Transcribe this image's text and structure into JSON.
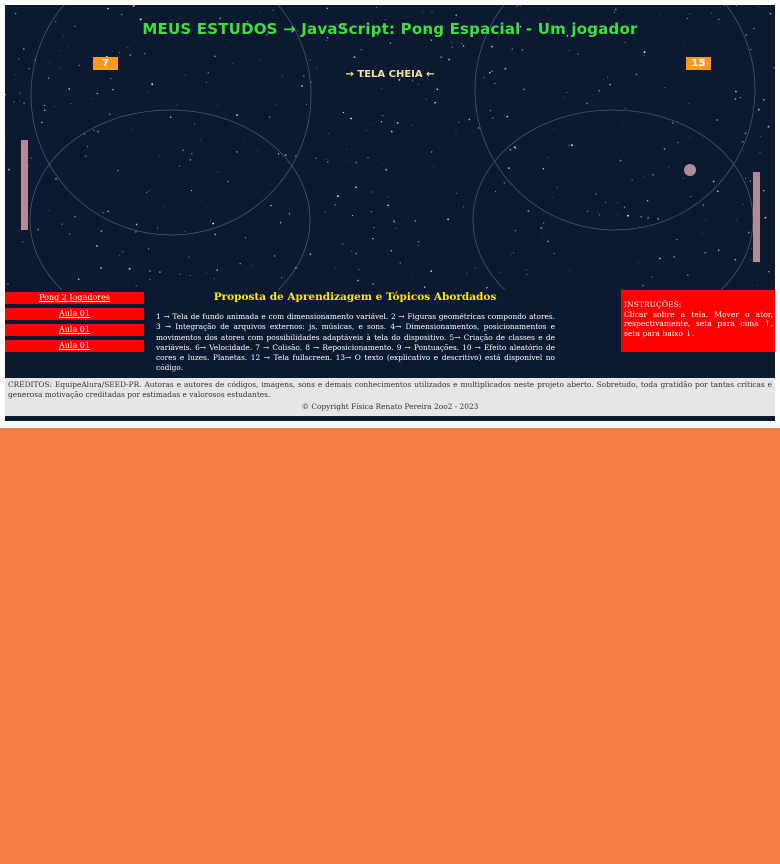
{
  "page": {
    "title": "MEUS ESTUDOS → JavaScript: Pong Espacial - Um jogador",
    "fullscreen_link": "→ TELA CHEIA ←"
  },
  "game": {
    "score_left": "7",
    "score_right": "15",
    "colors": {
      "background": "#0b1a30",
      "paddle": "#b48a98",
      "score_badge": "#ff9a1f",
      "title": "#3ee03e"
    }
  },
  "nav": {
    "items": [
      {
        "label": "Pong 2 Jogadores"
      },
      {
        "label": "Aula 01"
      },
      {
        "label": "Aula 01"
      },
      {
        "label": "Aula 01"
      }
    ]
  },
  "proposal": {
    "title": "Proposta de Aprendizagem e Tópicos Abordados",
    "text": "1 → Tela de fundo animada e com dimensionamento variável. 2 → Figuras geométricas compondo atores. 3 → Integração de arquivos externos: js, músicas, e sons. 4→ Dimensionamentos, posicionamentos e movimentos dos atores com possibilidades adaptáveis à tela do dispositivo. 5→ Criação de classes e de variáveis. 6→ Velocidade. 7 → Colisão. 8 → Reposicionamento. 9 → Pontuações. 10 → Efeito aleatório de cores e luzes. Planetas. 12 → Tela fullscreen. 13→ O texto (explicativo e descritivo) está disponível no código."
  },
  "instructions": {
    "title": "INSTRUÇÕES:",
    "text": "Clicar sobre a tela. Mover o ator, respectivamente, seta para cima ↑, seta para baixo ↓."
  },
  "credits": {
    "text": "CRÉDITOS: EquipeAlura/SEED-PR. Autoras e autores de códigos, imagens, sons e demais conhecimentos utilizados e multiplicados neste projeto aberto. Sobretudo, toda gratidão por tantas críticas e generosa motivação creditadas por estimadas e valorosos estudantes.",
    "copyright": "© Copyright Física Renato Pereira 2oo2 - 2023"
  }
}
